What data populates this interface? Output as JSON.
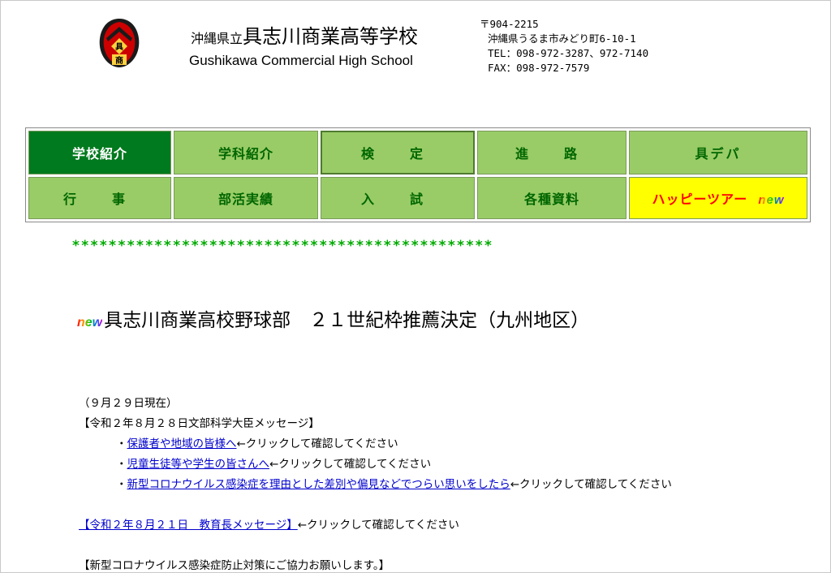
{
  "header": {
    "school_pref": "沖縄県立",
    "school_name": "具志川商業高等学校",
    "school_name_en": "Gushikawa Commercial High School",
    "emblem_text_top": "具",
    "emblem_text_bottom": "商",
    "address": {
      "postal": "〒904-2215",
      "street": "沖縄県うるま市みどり町6-10-1",
      "tel": "TEL：098-972-3287、972-7140",
      "fax": "FAX：098-972-7579"
    }
  },
  "nav": {
    "row1": [
      "学校紹介",
      "学科紹介",
      "検　定",
      "進　路",
      "具デパ"
    ],
    "row2": [
      "行　事",
      "部活実績",
      "入　試",
      "各種資料",
      "ハッピーツアー"
    ],
    "new_label": "new"
  },
  "divider": "**********************************************",
  "headline": {
    "new_label": "new",
    "text": "具志川商業高校野球部　２１世紀枠推薦決定（九州地区）"
  },
  "content": {
    "date_note": "（９月２９日現在）",
    "minister_heading": "【令和２年８月２８日文部科学大臣メッセージ】",
    "links": [
      {
        "bullet": "・",
        "link": "保護者や地域の皆様へ",
        "suffix": "←クリックして確認してください"
      },
      {
        "bullet": "・",
        "link": "児童生徒等や学生の皆さんへ",
        "suffix": "←クリックして確認してください"
      },
      {
        "bullet": "・",
        "link": "新型コロナウイルス感染症を理由とした差別や偏見などでつらい思いをしたら",
        "suffix": "←クリックして確認してください"
      }
    ],
    "superintendent_link": "【令和２年８月２１日　教育長メッセージ】",
    "superintendent_suffix": "←クリックして確認してください",
    "corona_heading": "【新型コロナウイルス感染症防止対策にご協力お願いします。】"
  },
  "colors": {
    "nav_green": "#99cc66",
    "nav_active": "#007a1e",
    "nav_text": "#006600",
    "happy_bg": "#ffff00",
    "happy_text": "#ff0000",
    "stars": "#00aa00",
    "link": "#0000cc"
  }
}
